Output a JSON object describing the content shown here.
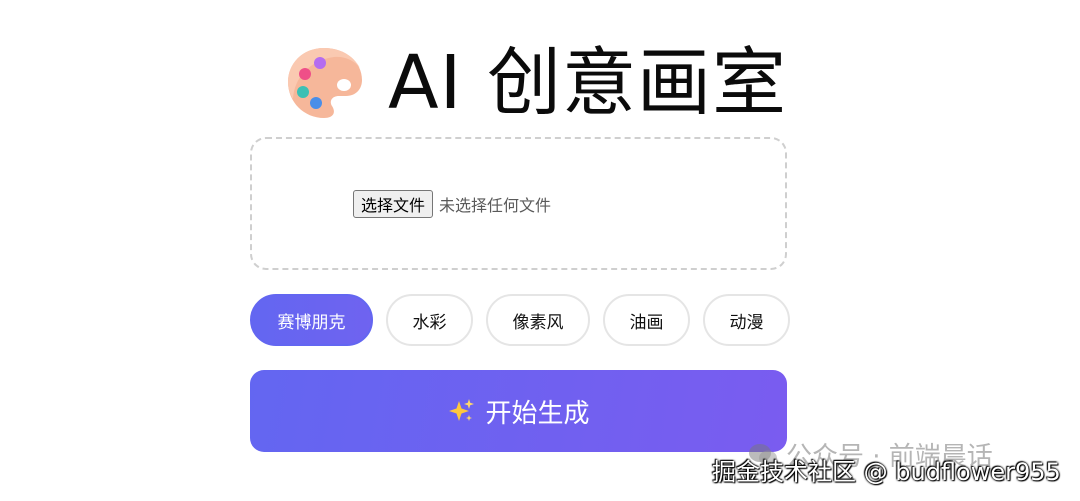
{
  "title": "AI 创意画室",
  "upload": {
    "button_label": "选择文件",
    "status": "未选择任何文件"
  },
  "styles": {
    "options": [
      "赛博朋克",
      "水彩",
      "像素风",
      "油画",
      "动漫"
    ],
    "selected": "赛博朋克"
  },
  "generate": {
    "label": "开始生成"
  },
  "icons": {
    "title": "palette-icon",
    "generate": "sparkles-icon",
    "watermark": "wechat-icon"
  },
  "colors": {
    "accent": "#6366f1",
    "accent_end": "#7a5cf0",
    "chip_border": "#e5e5e5",
    "dash_border": "#cfcfcf"
  },
  "watermarks": {
    "wechat": "公众号 · 前端晨话",
    "juejin": "掘金技术社区 @ budflower955"
  }
}
